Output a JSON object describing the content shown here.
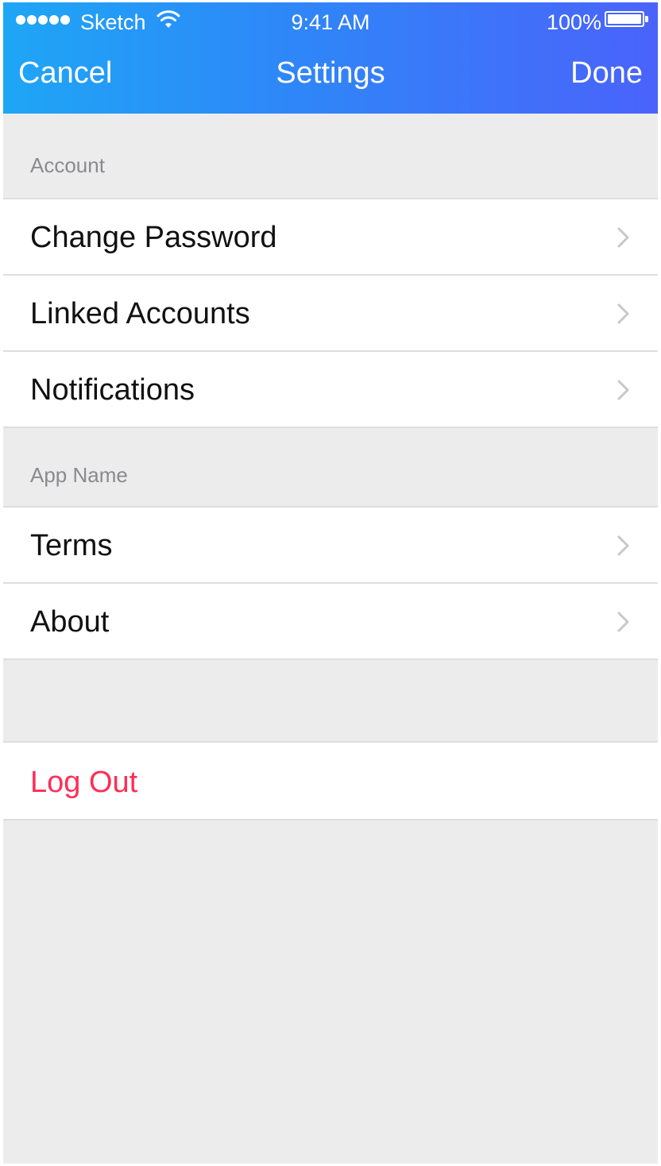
{
  "status_bar": {
    "carrier": "Sketch",
    "time": "9:41 AM",
    "battery_percent": "100%",
    "battery_level": 1.0,
    "signal_bars": 5,
    "wifi_icon": "wifi-icon"
  },
  "nav": {
    "cancel_label": "Cancel",
    "title": "Settings",
    "done_label": "Done",
    "gradient_start": "#1ea6f6",
    "gradient_end": "#4a63fb"
  },
  "sections": [
    {
      "header": "Account",
      "items": [
        {
          "label": "Change Password",
          "icon": "chevron-right-icon"
        },
        {
          "label": "Linked Accounts",
          "icon": "chevron-right-icon"
        },
        {
          "label": "Notifications",
          "icon": "chevron-right-icon"
        }
      ]
    },
    {
      "header": "App Name",
      "items": [
        {
          "label": "Terms",
          "icon": "chevron-right-icon"
        },
        {
          "label": "About",
          "icon": "chevron-right-icon"
        }
      ]
    }
  ],
  "logout": {
    "label": "Log Out",
    "color": "#ff2d55"
  },
  "colors": {
    "background": "#ececec",
    "row_background": "#ffffff",
    "separator": "#dedede",
    "section_header_text": "#8a8a8f",
    "chevron": "#c7c7cc"
  }
}
